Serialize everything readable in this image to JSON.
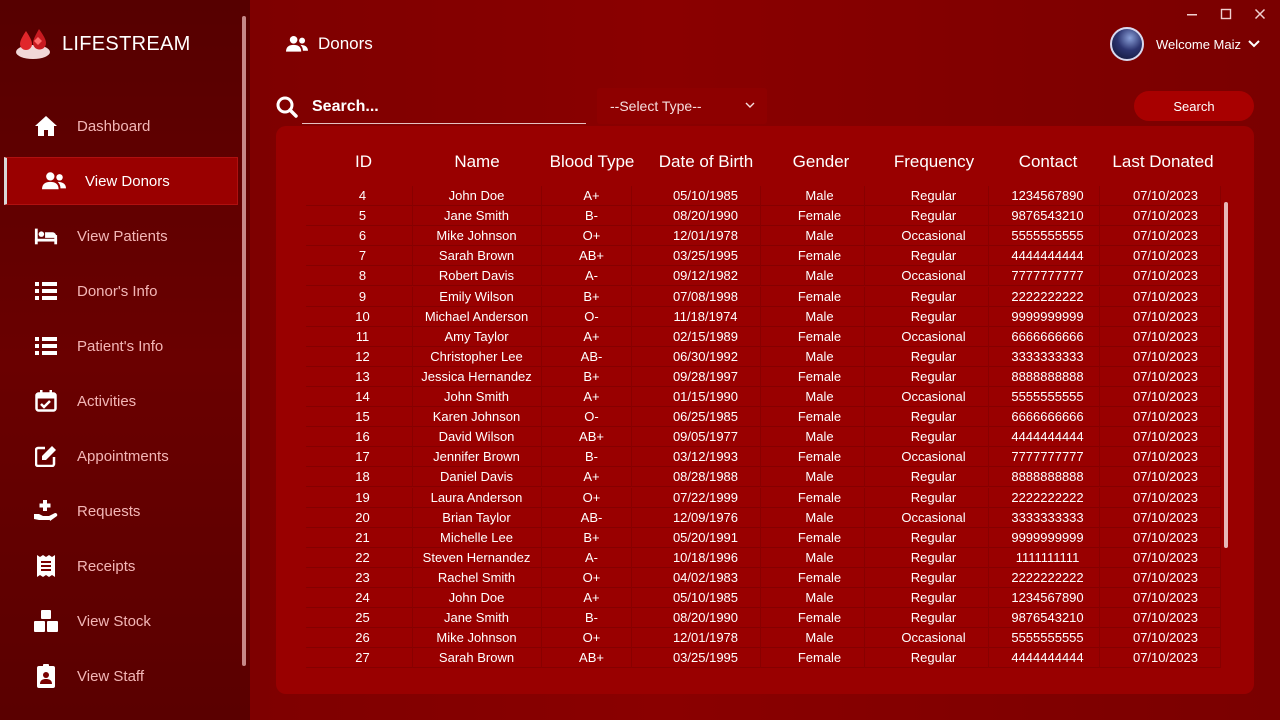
{
  "app": {
    "name": "LIFESTREAM"
  },
  "sidebar": {
    "items": [
      {
        "label": "Dashboard",
        "icon": "home-icon",
        "active": false
      },
      {
        "label": "View Donors",
        "icon": "users-icon",
        "active": true
      },
      {
        "label": "View Patients",
        "icon": "bed-icon",
        "active": false
      },
      {
        "label": "Donor's Info",
        "icon": "list-icon",
        "active": false
      },
      {
        "label": "Patient's Info",
        "icon": "list-icon",
        "active": false
      },
      {
        "label": "Activities",
        "icon": "calendar-check-icon",
        "active": false
      },
      {
        "label": "Appointments",
        "icon": "edit-icon",
        "active": false
      },
      {
        "label": "Requests",
        "icon": "hand-plus-icon",
        "active": false
      },
      {
        "label": "Receipts",
        "icon": "receipt-icon",
        "active": false
      },
      {
        "label": "View Stock",
        "icon": "boxes-icon",
        "active": false
      },
      {
        "label": "View Staff",
        "icon": "id-badge-icon",
        "active": false
      }
    ]
  },
  "header": {
    "title": "Donors",
    "welcome": "Welcome Maiz"
  },
  "search": {
    "placeholder": "Search...",
    "select_value": "--Select Type--",
    "button_label": "Search"
  },
  "table": {
    "columns": [
      "ID",
      "Name",
      "Blood Type",
      "Date of Birth",
      "Gender",
      "Frequency",
      "Contact",
      "Last Donated"
    ],
    "rows": [
      [
        "4",
        "John Doe",
        "A+",
        "05/10/1985",
        "Male",
        "Regular",
        "1234567890",
        "07/10/2023"
      ],
      [
        "5",
        "Jane Smith",
        "B-",
        "08/20/1990",
        "Female",
        "Regular",
        "9876543210",
        "07/10/2023"
      ],
      [
        "6",
        "Mike Johnson",
        "O+",
        "12/01/1978",
        "Male",
        "Occasional",
        "5555555555",
        "07/10/2023"
      ],
      [
        "7",
        "Sarah Brown",
        "AB+",
        "03/25/1995",
        "Female",
        "Regular",
        "4444444444",
        "07/10/2023"
      ],
      [
        "8",
        "Robert Davis",
        "A-",
        "09/12/1982",
        "Male",
        "Occasional",
        "7777777777",
        "07/10/2023"
      ],
      [
        "9",
        "Emily Wilson",
        "B+",
        "07/08/1998",
        "Female",
        "Regular",
        "2222222222",
        "07/10/2023"
      ],
      [
        "10",
        "Michael Anderson",
        "O-",
        "11/18/1974",
        "Male",
        "Regular",
        "9999999999",
        "07/10/2023"
      ],
      [
        "11",
        "Amy Taylor",
        "A+",
        "02/15/1989",
        "Female",
        "Occasional",
        "6666666666",
        "07/10/2023"
      ],
      [
        "12",
        "Christopher Lee",
        "AB-",
        "06/30/1992",
        "Male",
        "Regular",
        "3333333333",
        "07/10/2023"
      ],
      [
        "13",
        "Jessica Hernandez",
        "B+",
        "09/28/1997",
        "Female",
        "Regular",
        "8888888888",
        "07/10/2023"
      ],
      [
        "14",
        "John Smith",
        "A+",
        "01/15/1990",
        "Male",
        "Occasional",
        "5555555555",
        "07/10/2023"
      ],
      [
        "15",
        "Karen Johnson",
        "O-",
        "06/25/1985",
        "Female",
        "Regular",
        "6666666666",
        "07/10/2023"
      ],
      [
        "16",
        "David Wilson",
        "AB+",
        "09/05/1977",
        "Male",
        "Regular",
        "4444444444",
        "07/10/2023"
      ],
      [
        "17",
        "Jennifer Brown",
        "B-",
        "03/12/1993",
        "Female",
        "Occasional",
        "7777777777",
        "07/10/2023"
      ],
      [
        "18",
        "Daniel Davis",
        "A+",
        "08/28/1988",
        "Male",
        "Regular",
        "8888888888",
        "07/10/2023"
      ],
      [
        "19",
        "Laura Anderson",
        "O+",
        "07/22/1999",
        "Female",
        "Regular",
        "2222222222",
        "07/10/2023"
      ],
      [
        "20",
        "Brian Taylor",
        "AB-",
        "12/09/1976",
        "Male",
        "Occasional",
        "3333333333",
        "07/10/2023"
      ],
      [
        "21",
        "Michelle Lee",
        "B+",
        "05/20/1991",
        "Female",
        "Regular",
        "9999999999",
        "07/10/2023"
      ],
      [
        "22",
        "Steven Hernandez",
        "A-",
        "10/18/1996",
        "Male",
        "Regular",
        "1111111111",
        "07/10/2023"
      ],
      [
        "23",
        "Rachel Smith",
        "O+",
        "04/02/1983",
        "Female",
        "Regular",
        "2222222222",
        "07/10/2023"
      ],
      [
        "24",
        "John Doe",
        "A+",
        "05/10/1985",
        "Male",
        "Regular",
        "1234567890",
        "07/10/2023"
      ],
      [
        "25",
        "Jane Smith",
        "B-",
        "08/20/1990",
        "Female",
        "Regular",
        "9876543210",
        "07/10/2023"
      ],
      [
        "26",
        "Mike Johnson",
        "O+",
        "12/01/1978",
        "Male",
        "Occasional",
        "5555555555",
        "07/10/2023"
      ],
      [
        "27",
        "Sarah Brown",
        "AB+",
        "03/25/1995",
        "Female",
        "Regular",
        "4444444444",
        "07/10/2023"
      ]
    ]
  },
  "colors": {
    "sidebar": "#5a0000",
    "main": "#7a0000",
    "panel": "#990000",
    "accent": "#a80000"
  }
}
